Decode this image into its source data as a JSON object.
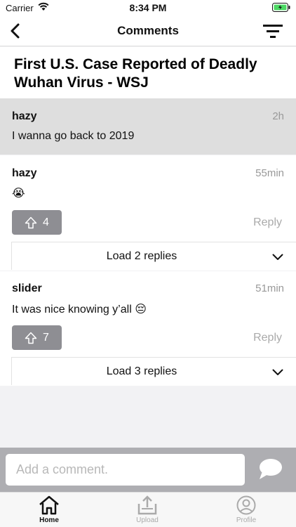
{
  "status": {
    "carrier": "Carrier",
    "time": "8:34 PM"
  },
  "nav": {
    "title": "Comments"
  },
  "article": {
    "headline": "First U.S. Case Reported of Deadly Wuhan Virus - WSJ"
  },
  "comments": [
    {
      "author": "hazy",
      "age": "2h",
      "body": "I wanna go back to 2019",
      "highlighted": true
    },
    {
      "author": "hazy",
      "age": "55min",
      "body": "😭",
      "upvotes": "4",
      "reply_label": "Reply",
      "load_label": "Load 2 replies"
    },
    {
      "author": "slider",
      "age": "51min",
      "body": "It was nice knowing y’all 😔",
      "upvotes": "7",
      "reply_label": "Reply",
      "load_label": "Load 3 replies"
    }
  ],
  "composer": {
    "placeholder": "Add a comment."
  },
  "tabs": [
    {
      "label": "Home",
      "icon": "home-icon",
      "active": true
    },
    {
      "label": "Upload",
      "icon": "upload-icon",
      "active": false
    },
    {
      "label": "Profile",
      "icon": "profile-icon",
      "active": false
    }
  ],
  "colors": {
    "highlight": "#dedede",
    "upvote_bg": "#8e8e93",
    "composer_bg": "#aeaeb2"
  }
}
